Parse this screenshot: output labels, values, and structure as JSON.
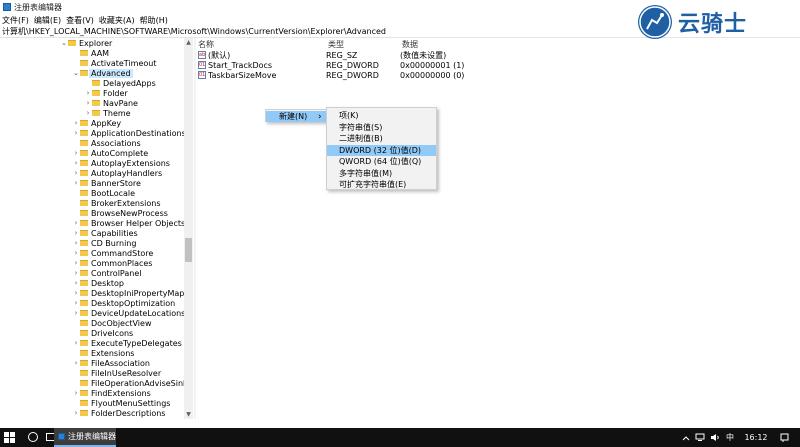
{
  "window": {
    "title": "注册表编辑器"
  },
  "menu": [
    "文件(F)",
    "编辑(E)",
    "查看(V)",
    "收藏夹(A)",
    "帮助(H)"
  ],
  "address": "计算机\\HKEY_LOCAL_MACHINE\\SOFTWARE\\Microsoft\\Windows\\CurrentVersion\\Explorer\\Advanced",
  "tree": [
    {
      "label": "Explorer",
      "indent": 0,
      "chev": "v"
    },
    {
      "label": "AAM",
      "indent": 1,
      "chev": ""
    },
    {
      "label": "ActivateTimeout",
      "indent": 1,
      "chev": ""
    },
    {
      "label": "Advanced",
      "indent": 1,
      "chev": "v",
      "selected": true
    },
    {
      "label": "DelayedApps",
      "indent": 2,
      "chev": ""
    },
    {
      "label": "Folder",
      "indent": 2,
      "chev": ">"
    },
    {
      "label": "NavPane",
      "indent": 2,
      "chev": ">"
    },
    {
      "label": "Theme",
      "indent": 2,
      "chev": ">"
    },
    {
      "label": "AppKey",
      "indent": 1,
      "chev": ">"
    },
    {
      "label": "ApplicationDestinations",
      "indent": 1,
      "chev": ">"
    },
    {
      "label": "Associations",
      "indent": 1,
      "chev": ""
    },
    {
      "label": "AutoComplete",
      "indent": 1,
      "chev": ">"
    },
    {
      "label": "AutoplayExtensions",
      "indent": 1,
      "chev": ">"
    },
    {
      "label": "AutoplayHandlers",
      "indent": 1,
      "chev": ">"
    },
    {
      "label": "BannerStore",
      "indent": 1,
      "chev": ">"
    },
    {
      "label": "BootLocale",
      "indent": 1,
      "chev": ""
    },
    {
      "label": "BrokerExtensions",
      "indent": 1,
      "chev": ""
    },
    {
      "label": "BrowseNewProcess",
      "indent": 1,
      "chev": ""
    },
    {
      "label": "Browser Helper Objects",
      "indent": 1,
      "chev": ">"
    },
    {
      "label": "Capabilities",
      "indent": 1,
      "chev": ">"
    },
    {
      "label": "CD Burning",
      "indent": 1,
      "chev": ">"
    },
    {
      "label": "CommandStore",
      "indent": 1,
      "chev": ">"
    },
    {
      "label": "CommonPlaces",
      "indent": 1,
      "chev": ">"
    },
    {
      "label": "ControlPanel",
      "indent": 1,
      "chev": ">"
    },
    {
      "label": "Desktop",
      "indent": 1,
      "chev": ">"
    },
    {
      "label": "DesktopIniPropertyMap",
      "indent": 1,
      "chev": ">"
    },
    {
      "label": "DesktopOptimization",
      "indent": 1,
      "chev": ">"
    },
    {
      "label": "DeviceUpdateLocations",
      "indent": 1,
      "chev": ">"
    },
    {
      "label": "DocObjectView",
      "indent": 1,
      "chev": ""
    },
    {
      "label": "DriveIcons",
      "indent": 1,
      "chev": ""
    },
    {
      "label": "ExecuteTypeDelegates",
      "indent": 1,
      "chev": ">"
    },
    {
      "label": "Extensions",
      "indent": 1,
      "chev": ""
    },
    {
      "label": "FileAssociation",
      "indent": 1,
      "chev": ">"
    },
    {
      "label": "FileInUseResolver",
      "indent": 1,
      "chev": ""
    },
    {
      "label": "FileOperationAdviseSinks",
      "indent": 1,
      "chev": ""
    },
    {
      "label": "FindExtensions",
      "indent": 1,
      "chev": ">"
    },
    {
      "label": "FlyoutMenuSettings",
      "indent": 1,
      "chev": ""
    },
    {
      "label": "FolderDescriptions",
      "indent": 1,
      "chev": ">"
    }
  ],
  "columns": {
    "name": "名称",
    "type": "类型",
    "data": "数据"
  },
  "values": [
    {
      "icon": "ab",
      "name": "(默认)",
      "type": "REG_SZ",
      "data": "(数值未设置)"
    },
    {
      "icon": "01",
      "name": "Start_TrackDocs",
      "type": "REG_DWORD",
      "data": "0x00000001 (1)"
    },
    {
      "icon": "01",
      "name": "TaskbarSizeMove",
      "type": "REG_DWORD",
      "data": "0x00000000 (0)"
    }
  ],
  "context_menu": {
    "new_label": "新建(N)",
    "arrow": "›"
  },
  "submenu": [
    {
      "label": "项(K)"
    },
    {
      "label": "字符串值(S)"
    },
    {
      "label": "二进制值(B)"
    },
    {
      "label": "DWORD (32 位)值(D)",
      "highlight": true
    },
    {
      "label": "QWORD (64 位)值(Q)"
    },
    {
      "label": "多字符串值(M)"
    },
    {
      "label": "可扩充字符串值(E)"
    }
  ],
  "taskbar": {
    "app_label": "注册表编辑器",
    "ime": "中",
    "clock": "16:12"
  },
  "logo": {
    "text": "云骑士"
  },
  "colors": {
    "selection": "#cce8ff",
    "menu_highlight": "#91c9f7",
    "taskbar": "#101010",
    "logo": "#1f5fa3"
  }
}
